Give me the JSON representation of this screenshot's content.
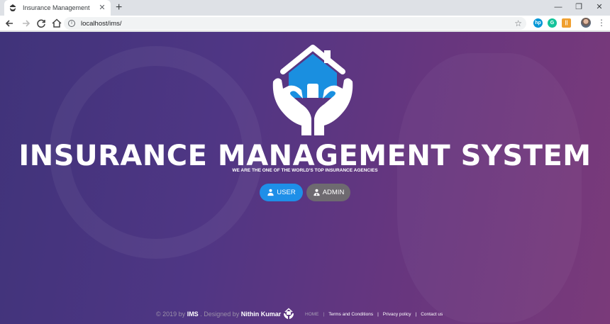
{
  "browser": {
    "tab_title": "Insurance Management",
    "url": "localhost/ims/",
    "new_tab": "+",
    "close_tab": "✕",
    "window": {
      "minimize": "—",
      "restore": "❐",
      "close": "✕"
    },
    "extensions": [
      {
        "name": "hp-icon",
        "label": "hp",
        "color": "#0096d6"
      },
      {
        "name": "grammarly-icon",
        "label": "G",
        "color": "#15c39a"
      },
      {
        "name": "extension-icon",
        "label": "||",
        "color": "#f0a030"
      }
    ]
  },
  "hero": {
    "title": "INSURANCE MANAGEMENT SYSTEM",
    "subtitle": "WE ARE THE ONE OF THE WORLD'S TOP INSURANCE AGENCIES",
    "user_button": "USER",
    "admin_button": "ADMIN"
  },
  "footer": {
    "copyright_prefix": "© 2019 by",
    "brand": "IMS",
    "designed_by": ". Designed by",
    "designer": "Nithin Kumar",
    "links": [
      "HOME",
      "Terms and Conditions",
      "Privacy policy",
      "Contact us"
    ],
    "separator": "|"
  },
  "colors": {
    "user_button": "#1e8fe8",
    "admin_button": "#6e6a70",
    "logo_blue": "#1a8fe0"
  }
}
